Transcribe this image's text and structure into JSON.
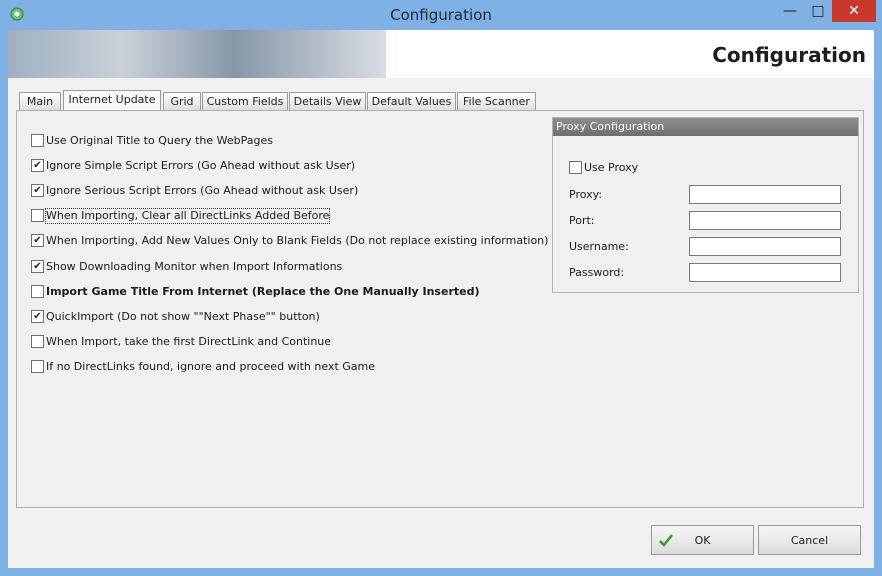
{
  "window": {
    "title": "Configuration"
  },
  "banner": {
    "title": "Configuration"
  },
  "tabs": [
    {
      "label": "Main"
    },
    {
      "label": "Internet Update"
    },
    {
      "label": "Grid"
    },
    {
      "label": "Custom Fields"
    },
    {
      "label": "Details View"
    },
    {
      "label": "Default Values"
    },
    {
      "label": "File Scanner"
    }
  ],
  "options": [
    {
      "label": "Use Original Title to Query the WebPages",
      "checked": false
    },
    {
      "label": "Ignore Simple Script Errors (Go Ahead without ask User)",
      "checked": true
    },
    {
      "label": "Ignore Serious Script Errors (Go Ahead without ask User)",
      "checked": true
    },
    {
      "label": "When Importing, Clear all DirectLinks Added Before",
      "checked": false
    },
    {
      "label": "When Importing, Add New Values Only to Blank Fields (Do not replace existing information)",
      "checked": true
    },
    {
      "label": "Show Downloading Monitor when Import Informations",
      "checked": true
    },
    {
      "label": "Import Game Title From Internet (Replace the One Manually Inserted)",
      "checked": false
    },
    {
      "label": "QuickImport (Do not show \"\"Next Phase\"\" button)",
      "checked": true
    },
    {
      "label": "When Import, take the first DirectLink and Continue",
      "checked": false
    },
    {
      "label": "If no DirectLinks found, ignore and proceed with next Game",
      "checked": false
    }
  ],
  "proxy": {
    "title": "Proxy Configuration",
    "use_proxy": {
      "label": "Use Proxy",
      "checked": false
    },
    "proxy_label": "Proxy:",
    "port_label": "Port:",
    "username_label": "Username:",
    "password_label": "Password:",
    "proxy_value": "",
    "port_value": "",
    "username_value": "",
    "password_value": ""
  },
  "buttons": {
    "ok": "OK",
    "cancel": "Cancel"
  },
  "icons": {
    "app": "gear-recycle-icon",
    "ok": "checkmark-icon"
  },
  "colors": {
    "titlebar": "#7fb1e4",
    "close": "#c7392c",
    "proxy_header": "#7e7e7e"
  }
}
